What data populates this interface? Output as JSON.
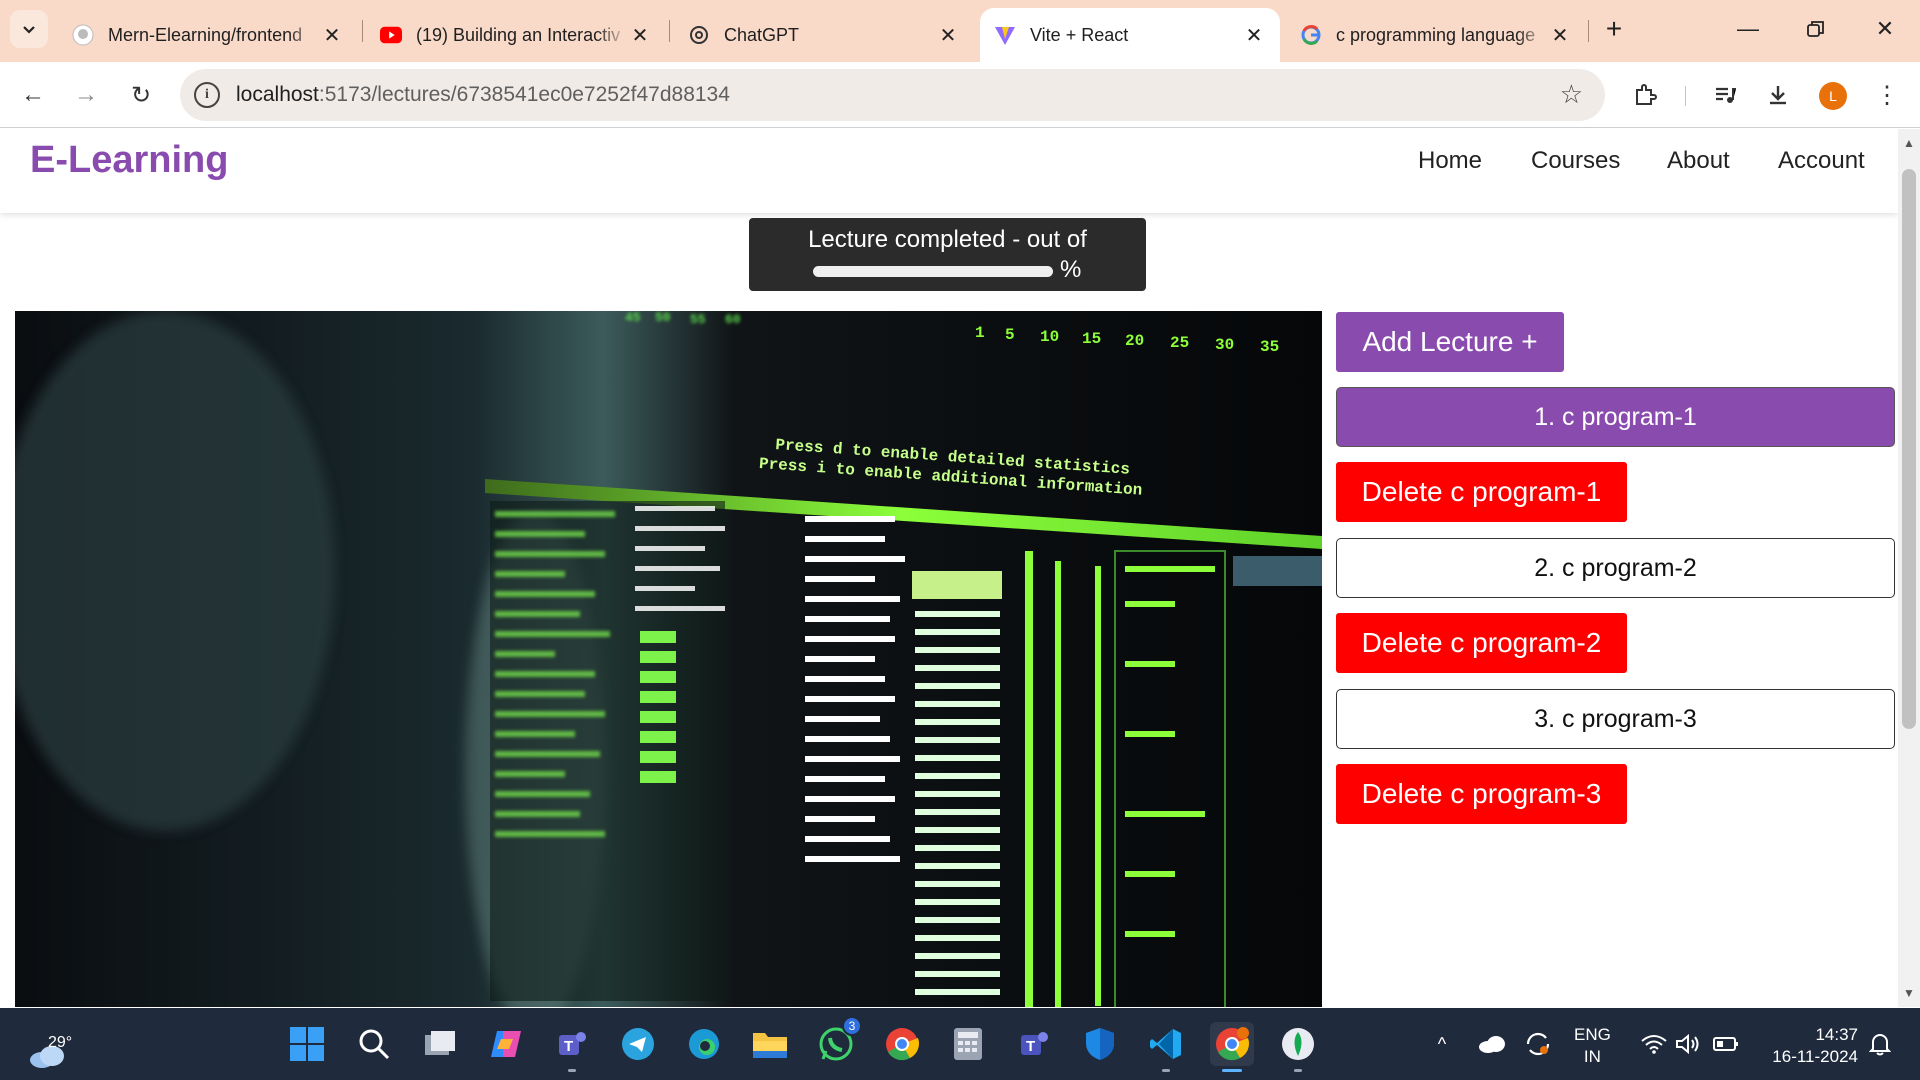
{
  "browser": {
    "tabs": [
      {
        "title": "Mern-Elearning/frontend",
        "icon": "github-icon"
      },
      {
        "title": "(19) Building an Interactiv",
        "icon": "youtube-icon"
      },
      {
        "title": "ChatGPT",
        "icon": "chatgpt-icon"
      },
      {
        "title": "Vite + React",
        "icon": "vite-icon",
        "active": true
      },
      {
        "title": "c programming language",
        "icon": "google-icon"
      }
    ],
    "url_host": "localhost",
    "url_path": ":5173/lectures/6738541ec0e7252f47d88134",
    "profile_initial": "L"
  },
  "app": {
    "logo": "E-Learning",
    "nav": [
      "Home",
      "Courses",
      "About",
      "Account"
    ],
    "progress": {
      "text": "Lecture completed - out of",
      "percent_symbol": "%",
      "value": 0
    },
    "add_lecture_label": "Add Lecture +",
    "lectures": [
      {
        "label": "1. c program-1",
        "delete_label": "Delete c program-1",
        "active": true
      },
      {
        "label": "2. c program-2",
        "delete_label": "Delete c program-2",
        "active": false
      },
      {
        "label": "3. c program-3",
        "delete_label": "Delete c program-3",
        "active": false
      }
    ],
    "video_terminal": {
      "header_scale": [
        "45",
        "50",
        "55",
        "60"
      ],
      "header_scale_right": [
        "1",
        "5",
        "10",
        "15",
        "20",
        "25",
        "30",
        "35"
      ],
      "banner1": "Press d to enable detailed statistics",
      "banner2": "Press i to enable additional information"
    }
  },
  "taskbar": {
    "temperature": "29°",
    "whatsapp_badge": "3",
    "language_top": "ENG",
    "language_bottom": "IN",
    "time": "14:37",
    "date": "16-11-2024"
  },
  "colors": {
    "brand": "#8a4baf",
    "danger": "#ff0000",
    "tabstrip": "#f9d9c8",
    "taskbar": "#1f2a3c"
  }
}
